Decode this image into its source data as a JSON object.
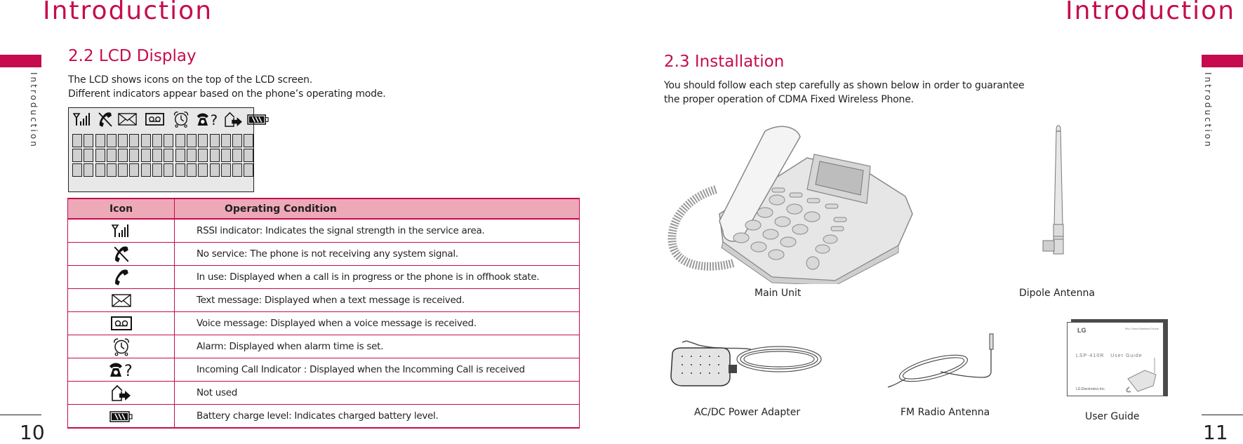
{
  "left_page": {
    "header_title": "Introduction",
    "side_tab_label": "Introduction",
    "page_number": "10",
    "section": {
      "title": "2.2 LCD Display",
      "paragraph_lines": [
        "The LCD shows icons on the top of the LCD screen.",
        "Different indicators appear based on the phone’s operating mode."
      ]
    },
    "lcd": {
      "status_icons": [
        "signal-strength-icon",
        "no-service-icon",
        "text-message-icon",
        "voice-message-icon",
        "alarm-icon",
        "incoming-call-icon",
        "not-used-icon",
        "battery-icon"
      ],
      "character_rows": 3,
      "character_columns": 16
    },
    "table": {
      "headers": {
        "icon": "Icon",
        "condition": "Operating Condition"
      },
      "rows": [
        {
          "icon": "signal-strength-icon",
          "text": "RSSI indicator: Indicates the signal strength in the service area."
        },
        {
          "icon": "no-service-icon",
          "text": "No service: The phone is not receiving any system signal."
        },
        {
          "icon": "in-use-icon",
          "text": "In use: Displayed when a call is in progress or the phone is in offhook state."
        },
        {
          "icon": "text-message-icon",
          "text": "Text message: Displayed when a text message is received."
        },
        {
          "icon": "voice-message-icon",
          "text": "Voice message: Displayed when a voice message is received."
        },
        {
          "icon": "alarm-icon",
          "text": "Alarm: Displayed when alarm time is set."
        },
        {
          "icon": "incoming-call-icon",
          "text": "Incoming Call Indicator : Displayed when the Incomming Call is received"
        },
        {
          "icon": "not-used-icon",
          "text": "Not used"
        },
        {
          "icon": "battery-icon",
          "text": "Battery charge level: Indicates charged battery level."
        }
      ]
    }
  },
  "right_page": {
    "header_title": "Introduction",
    "side_tab_label": "Introduction",
    "page_number": "11",
    "section": {
      "title": "2.3 Installation",
      "paragraph_lines": [
        "You should follow each step carefully as shown below in order to guarantee",
        "the proper operation of CDMA Fixed Wireless Phone."
      ]
    },
    "items": [
      {
        "id": "main-unit",
        "caption": "Main Unit"
      },
      {
        "id": "dipole-antenna",
        "caption": "Dipole Antenna"
      },
      {
        "id": "power-adapter",
        "caption": "AC/DC Power Adapter"
      },
      {
        "id": "fm-antenna",
        "caption": "FM Radio Antenna"
      },
      {
        "id": "user-guide",
        "caption": "User Guide"
      }
    ],
    "user_guide_cover": {
      "brand": "LG",
      "subtitle": "WLL Fixed Wireless Phone",
      "model": "LSP-410R",
      "title": "User Guide",
      "company": "LG Electronics Inc."
    }
  },
  "colors": {
    "accent": "#c60c4e",
    "table_header_bg": "#eda9b7",
    "lcd_bg": "#e8e8e8"
  }
}
